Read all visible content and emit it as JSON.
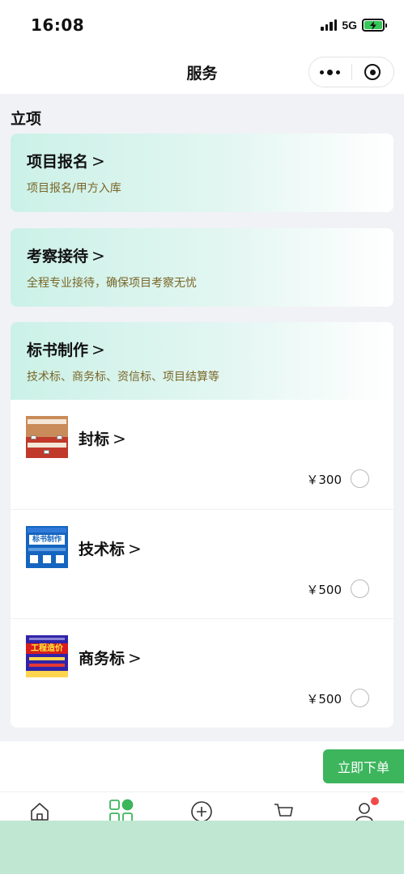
{
  "status_bar": {
    "time": "16:08",
    "network": "5G",
    "battery_color": "#35c759"
  },
  "nav": {
    "title": "服务",
    "more_icon": "more-dots-icon",
    "close_icon": "target-close-icon"
  },
  "section": {
    "title": "立项"
  },
  "cards": [
    {
      "title": "项目报名",
      "subtitle": "项目报名/甲方入库",
      "chevron": ">"
    },
    {
      "title": "考察接待",
      "subtitle": "全程专业接待，确保项目考察无忧",
      "chevron": ">"
    },
    {
      "title": "标书制作",
      "subtitle": "技术标、商务标、资信标、项目结算等",
      "chevron": ">"
    }
  ],
  "products": [
    {
      "name": "封标",
      "price": "￥300",
      "chevron": ">",
      "selected": false
    },
    {
      "name": "技术标",
      "price": "￥500",
      "chevron": ">",
      "selected": false,
      "thumb_text": "标书制作"
    },
    {
      "name": "商务标",
      "price": "￥500",
      "chevron": ">",
      "selected": false,
      "thumb_text": "工程造价"
    }
  ],
  "order_button": {
    "label": "立即下单",
    "color": "#3cb55c"
  },
  "tabbar": {
    "items": [
      {
        "icon": "home-icon"
      },
      {
        "icon": "services-grid-icon",
        "active": true
      },
      {
        "icon": "add-circle-icon"
      },
      {
        "icon": "cart-icon"
      },
      {
        "icon": "user-icon",
        "badge": true
      }
    ],
    "accent": "#3cb55c"
  }
}
